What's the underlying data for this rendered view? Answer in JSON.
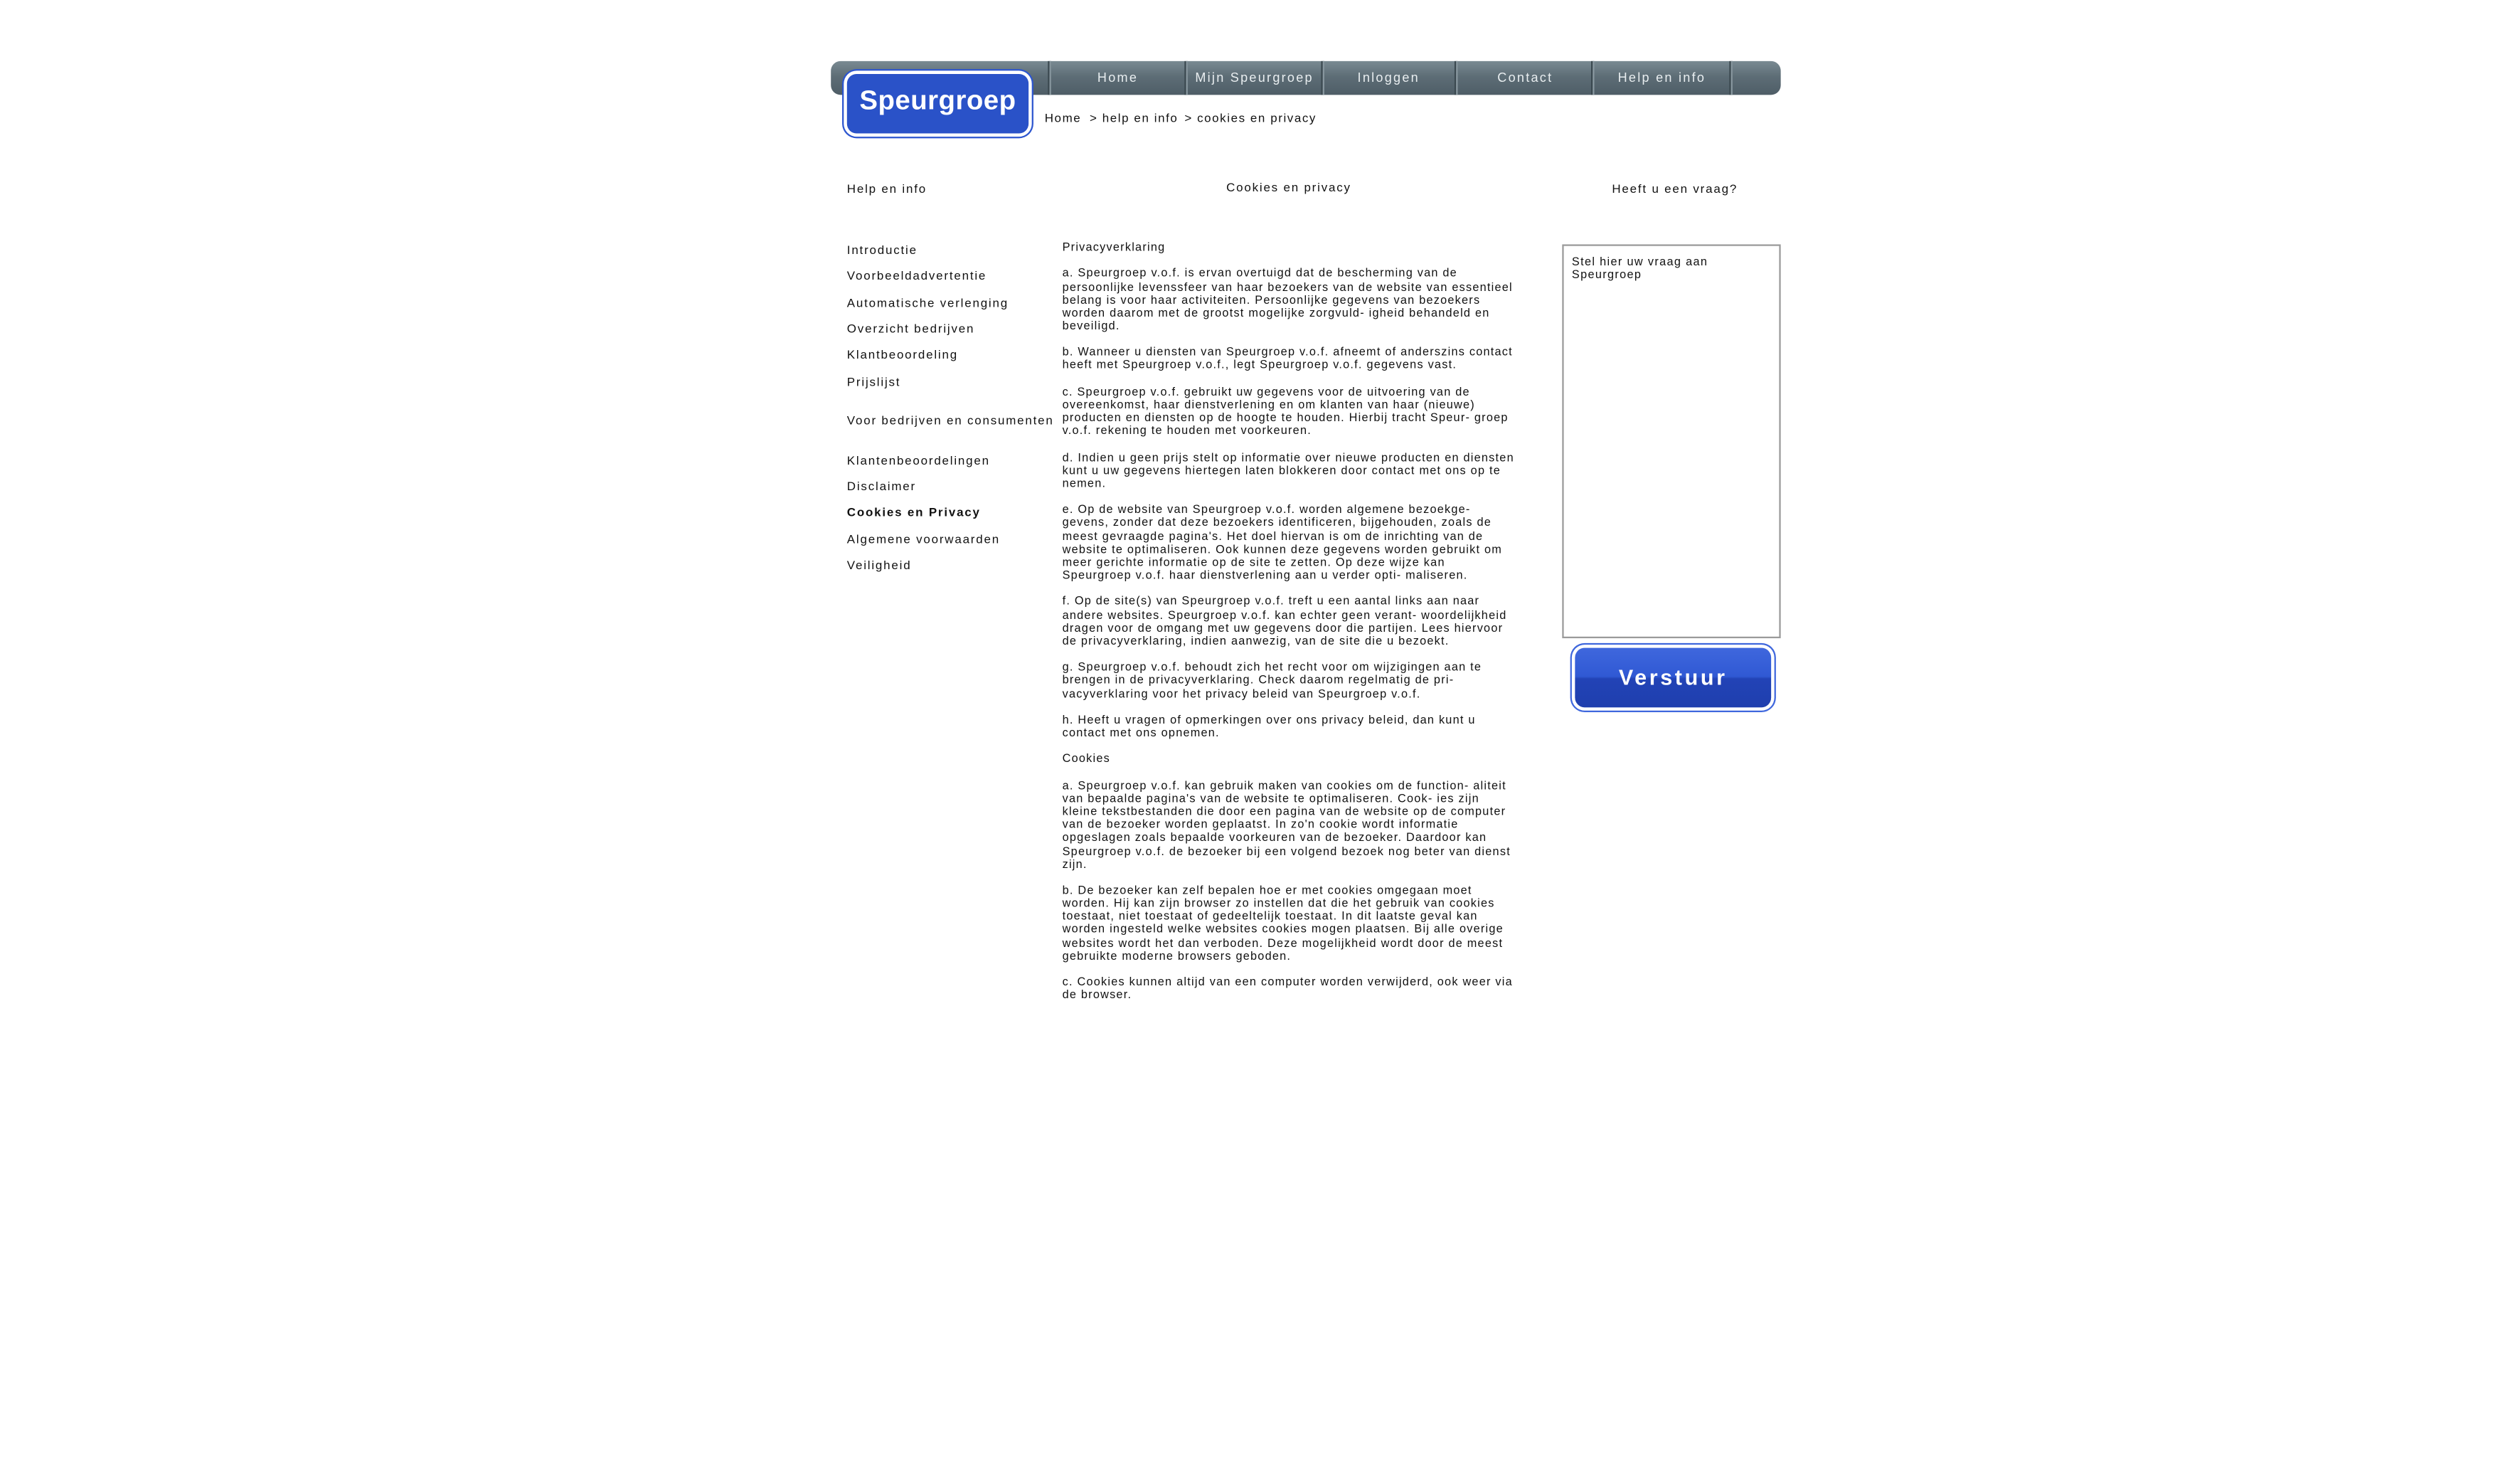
{
  "logo": {
    "text": "Speurgroep"
  },
  "nav": {
    "items": [
      {
        "label": "Home"
      },
      {
        "label": "Mijn Speurgroep"
      },
      {
        "label": "Inloggen"
      },
      {
        "label": "Contact"
      },
      {
        "label": "Help en info"
      }
    ]
  },
  "breadcrumb": {
    "home": "Home",
    "help": "> help en info",
    "current": "> cookies en privacy"
  },
  "headings": {
    "sidebar": "Help en info",
    "main": "Cookies en privacy",
    "right": "Heeft u een vraag?"
  },
  "sidebar": {
    "items": [
      {
        "label": "Introductie"
      },
      {
        "label": "Voorbeeldadvertentie"
      },
      {
        "label": "Automatische verlenging"
      },
      {
        "label": "Overzicht bedrijven"
      },
      {
        "label": "Klantbeoordeling"
      },
      {
        "label": "Prijslijst"
      },
      {
        "label": "Voor bedrijven en consumenten"
      },
      {
        "label": "Klantenbeoordelingen"
      },
      {
        "label": "Disclaimer"
      },
      {
        "label": "Cookies en Privacy"
      },
      {
        "label": "Algemene voorwaarden"
      },
      {
        "label": "Veiligheid"
      }
    ]
  },
  "content": {
    "privacy_title": "Privacyverklaring",
    "privacy": [
      "a. Speurgroep v.o.f. is ervan overtuigd dat de bescherming van de persoonlijke levenssfeer van haar bezoekers van de website van essentieel belang is voor haar activiteiten. Persoonlijke gegevens van bezoekers worden daarom met de grootst mogelijke zorgvuld- igheid behandeld en beveiligd.",
      "b. Wanneer u diensten van Speurgroep v.o.f. afneemt of anderszins contact heeft met Speurgroep v.o.f., legt Speurgroep v.o.f. gegevens vast.",
      "c. Speurgroep v.o.f. gebruikt uw gegevens voor de uitvoering van de overeenkomst, haar dienstverlening en om klanten van haar (nieuwe) producten en diensten op de hoogte te houden. Hierbij tracht Speur- groep v.o.f. rekening te houden met voorkeuren.",
      "d. Indien u geen prijs stelt op informatie over nieuwe producten en diensten kunt u uw gegevens hiertegen laten blokkeren door contact met ons op te nemen.",
      "e. Op de website van Speurgroep v.o.f. worden algemene bezoekge- gevens, zonder dat deze bezoekers identificeren, bijgehouden, zoals de meest gevraagde pagina's. Het doel hiervan is om de inrichting van de website te optimaliseren. Ook kunnen deze gegevens worden gebruikt om meer gerichte informatie op de site te zetten. Op deze wijze kan Speurgroep v.o.f. haar dienstverlening aan u verder opti- maliseren.",
      "f. Op de site(s) van Speurgroep v.o.f. treft u een aantal links aan naar andere websites. Speurgroep v.o.f. kan echter geen verant- woordelijkheid dragen voor de omgang met uw gegevens door die partijen. Lees hiervoor de privacyverklaring, indien aanwezig, van de site die u bezoekt.",
      "g. Speurgroep v.o.f. behoudt zich het recht voor om wijzigingen aan te brengen in de privacyverklaring. Check daarom regelmatig de pri- vacyverklaring voor het privacy beleid van Speurgroep v.o.f.",
      "h. Heeft u vragen of opmerkingen over ons privacy beleid, dan kunt u contact met ons opnemen."
    ],
    "cookies_title": "Cookies",
    "cookies": [
      "a. Speurgroep v.o.f. kan gebruik maken van cookies om de function- aliteit van bepaalde pagina's van de website te optimaliseren. Cook- ies zijn kleine tekstbestanden die door een pagina van de website op de computer van de bezoeker worden geplaatst. In zo'n cookie wordt informatie opgeslagen zoals bepaalde voorkeuren van de bezoeker. Daardoor kan Speurgroep v.o.f. de bezoeker bij een volgend bezoek nog beter van dienst zijn.",
      "b. De bezoeker kan zelf bepalen hoe er met cookies omgegaan moet worden. Hij kan zijn browser zo instellen dat die het gebruik van cookies toestaat, niet toestaat of gedeeltelijk toestaat. In dit laatste geval kan worden ingesteld welke websites cookies mogen plaatsen. Bij alle overige websites wordt het dan verboden. Deze mogelijkheid wordt door de meest gebruikte moderne browsers geboden.",
      "c. Cookies kunnen altijd van een computer worden verwijderd, ook weer via de browser."
    ]
  },
  "question": {
    "placeholder": "Stel hier uw vraag aan Speurgroep",
    "submit": "Verstuur"
  },
  "colors": {
    "nav_bar": "#5d6d76",
    "logo_blue": "#2a52c8",
    "button_blue": "#3059d4"
  }
}
